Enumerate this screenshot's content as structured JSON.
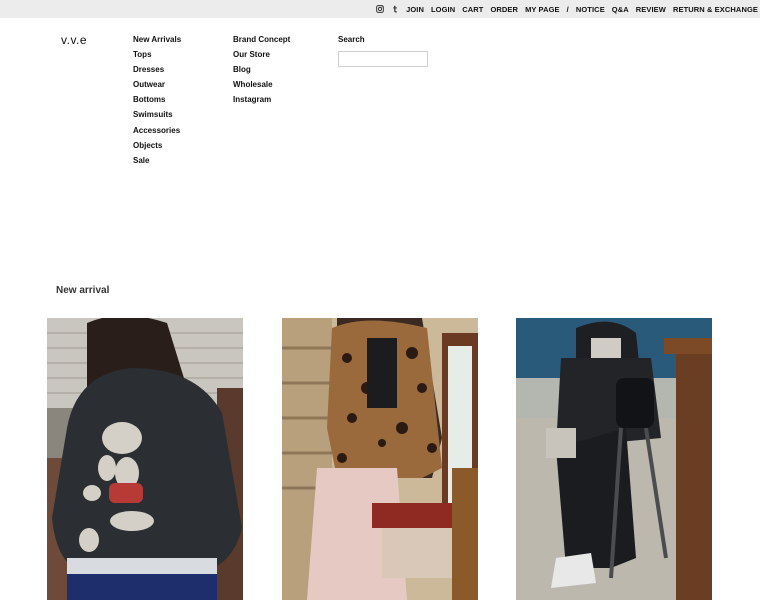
{
  "topnav": {
    "icons": [
      "instagram-icon",
      "tumblr-icon"
    ],
    "items": [
      "JOIN",
      "LOGIN",
      "CART",
      "ORDER",
      "MY PAGE",
      "/",
      "NOTICE",
      "Q&A",
      "REVIEW",
      "RETURN & EXCHANGE"
    ]
  },
  "brand": {
    "logo": "v.v.e"
  },
  "menu": {
    "shop": [
      "New Arrivals",
      "Tops",
      "Dresses",
      "Outwear",
      "Bottoms",
      "Swimsuits",
      "Accessories",
      "Objects",
      "Sale"
    ],
    "info": [
      "Brand Concept",
      "Our Store",
      "Blog",
      "Wholesale",
      "Instagram"
    ]
  },
  "search": {
    "label": "Search",
    "value": "",
    "placeholder": ""
  },
  "section": {
    "title": "New arrival"
  },
  "colors": {
    "topbar": "#ececec",
    "text": "#111111"
  }
}
